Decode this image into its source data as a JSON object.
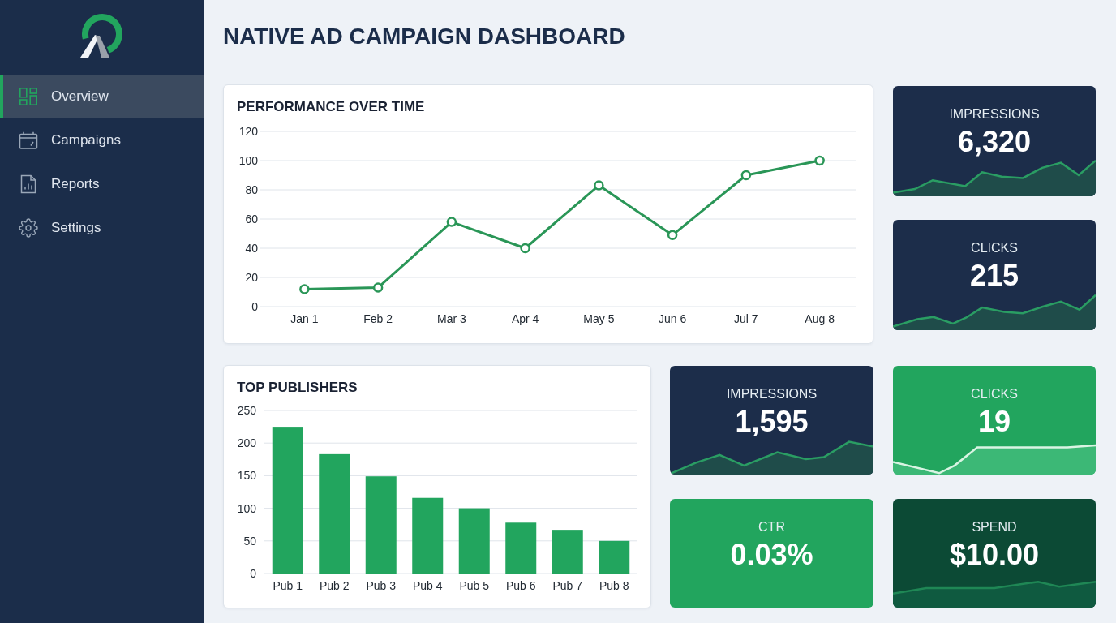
{
  "sidebar": {
    "items": [
      {
        "label": "Overview",
        "selected": true
      },
      {
        "label": "Campaigns",
        "selected": false
      },
      {
        "label": "Reports",
        "selected": false
      },
      {
        "label": "Settings",
        "selected": false
      }
    ]
  },
  "page_title": "NATIVE AD CAMPAIGN DASHBOARD",
  "performance_chart": {
    "chart_data": {
      "type": "line",
      "title": "PERFORMANCE OVER TIME",
      "categories": [
        "Jan 1",
        "Feb 2",
        "Mar 3",
        "Apr 4",
        "May 5",
        "Jun 6",
        "Jul 7",
        "Aug 8"
      ],
      "values": [
        12,
        13,
        58,
        40,
        83,
        49,
        90,
        100
      ],
      "ylim": [
        0,
        120
      ],
      "yticks": [
        0,
        20,
        40,
        60,
        80,
        100,
        120
      ],
      "grid": true,
      "marker": true
    }
  },
  "top_publishers": {
    "chart_data": {
      "type": "bar",
      "title": "TOP PUBLISHERS",
      "categories": [
        "Pub 1",
        "Pub 2",
        "Pub 3",
        "Pub 4",
        "Pub 5",
        "Pub 6",
        "Pub 7",
        "Pub 8"
      ],
      "values": [
        225,
        183,
        149,
        116,
        100,
        78,
        67,
        50
      ],
      "ylim": [
        0,
        250
      ],
      "yticks": [
        0,
        50,
        100,
        150,
        200,
        250
      ],
      "grid": true
    }
  },
  "stat_cards": [
    {
      "label": "IMPRESSIONS",
      "value": "6,320",
      "color": "#1c2d4a",
      "sparkline": true
    },
    {
      "label": "CLICKS",
      "value": "215",
      "color": "#1c2d4a",
      "sparkline": true
    },
    {
      "label": "IMPRESSIONS",
      "value": "1,595",
      "color": "#1c2d4a",
      "sparkline": true
    },
    {
      "label": "CLICKS",
      "value": "19",
      "color": "#22a55e",
      "sparkline": true
    },
    {
      "label": "CTR",
      "value": "0.03%",
      "color": "#22a55e",
      "sparkline": false
    },
    {
      "label": "SPEND",
      "value": "$10.00",
      "color": "#0c4a35",
      "sparkline": true
    }
  ]
}
